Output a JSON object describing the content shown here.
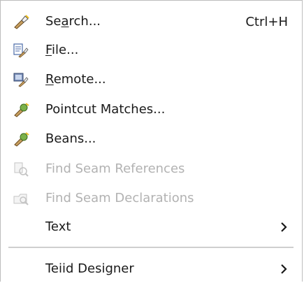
{
  "menu": {
    "items": [
      {
        "pre": "Se",
        "mn": "a",
        "post": "rch...",
        "accel": "Ctrl+H",
        "icon": "search-wand-icon"
      },
      {
        "pre": "",
        "mn": "F",
        "post": "ile...",
        "icon": "file-search-icon"
      },
      {
        "pre": "",
        "mn": "R",
        "post": "emote...",
        "icon": "remote-search-icon"
      },
      {
        "pre": "Pointcut Matches...",
        "mn": "",
        "post": "",
        "icon": "pointcut-search-icon"
      },
      {
        "pre": "Beans...",
        "mn": "",
        "post": "",
        "icon": "beans-search-icon"
      },
      {
        "pre": "Find Seam References",
        "mn": "",
        "post": "",
        "icon": "seam-references-icon",
        "disabled": true
      },
      {
        "pre": "Find Seam Declarations",
        "mn": "",
        "post": "",
        "icon": "seam-declarations-icon",
        "disabled": true
      },
      {
        "pre": "Text",
        "mn": "",
        "post": "",
        "submenu": true
      },
      {
        "pre": "Teiid Designer",
        "mn": "",
        "post": "",
        "submenu": true
      }
    ]
  }
}
